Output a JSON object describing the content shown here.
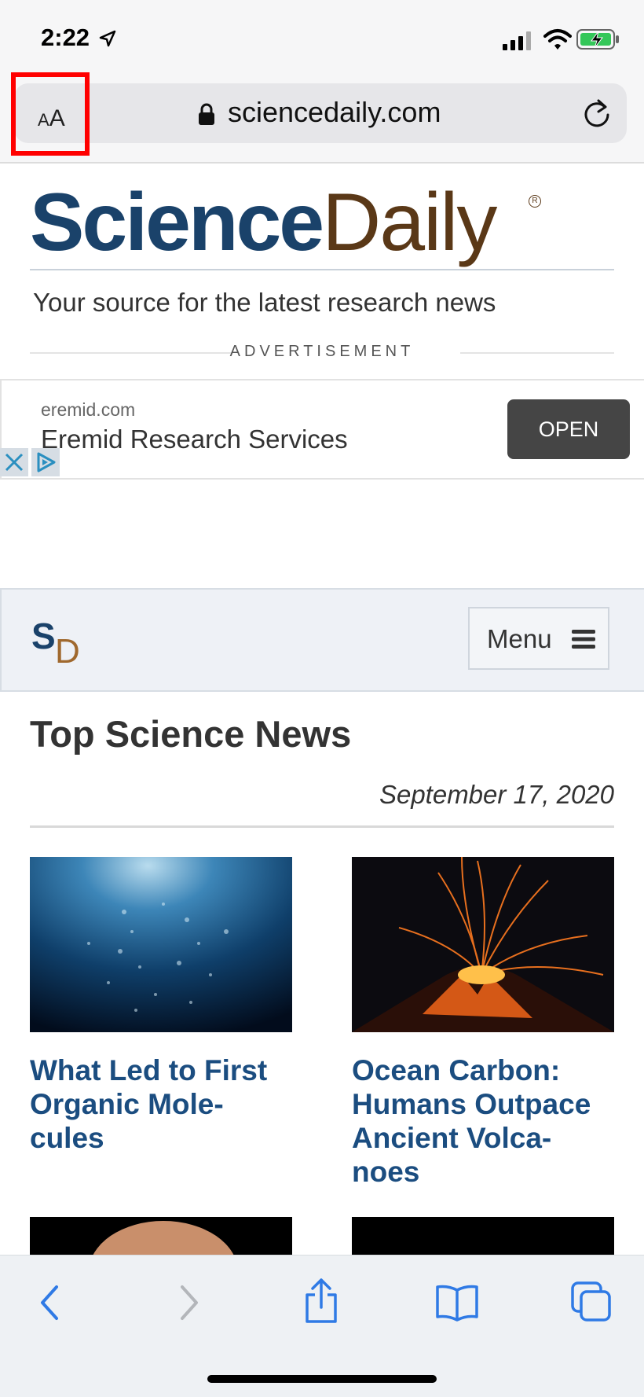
{
  "status_bar": {
    "time": "2:22"
  },
  "browser": {
    "text_size_button": {
      "small_a": "A",
      "large_a": "A"
    },
    "url": "sciencedaily.com"
  },
  "site": {
    "logo_part1": "Science",
    "logo_part2": "Daily",
    "tagline": "Your source for the latest research news",
    "ad_label": "ADVERTISEMENT"
  },
  "ad": {
    "domain": "eremid.com",
    "title": "Eremid Research Services",
    "button": "OPEN"
  },
  "nav": {
    "logo_s": "S",
    "logo_d": "D",
    "menu_label": "Menu"
  },
  "content": {
    "heading": "Top Science News",
    "date": "September 17, 2020",
    "articles": [
      {
        "title": "What Led to First Organic Mole-cules",
        "lines": [
          "What Led to First",
          "Organic Mole-",
          "cules"
        ]
      },
      {
        "title": "Ocean Carbon: Humans Outpace Ancient Volca-noes",
        "lines": [
          "Ocean Carbon:",
          "Humans Outpace",
          "Ancient Volca-",
          "noes"
        ]
      }
    ]
  },
  "colors": {
    "logo_blue": "#1a426a",
    "logo_brown": "#5a3817",
    "link_blue": "#1b4d80",
    "ios_blue": "#2f7ae5",
    "highlight_red": "#ff0000"
  },
  "toolbar": {
    "icons": [
      "back-icon",
      "forward-icon",
      "share-icon",
      "bookmarks-icon",
      "tabs-icon"
    ]
  }
}
